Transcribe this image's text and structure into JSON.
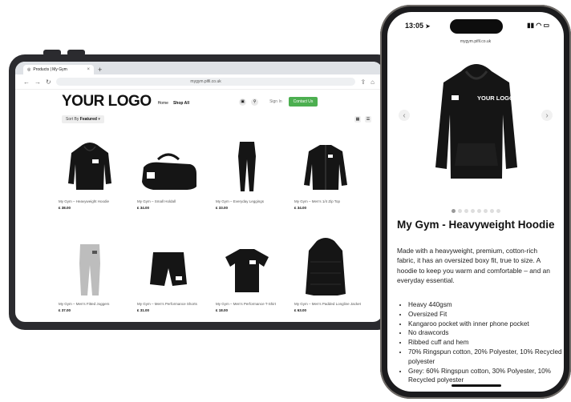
{
  "tablet": {
    "tab_title": "Products | My Gym",
    "tab_close": "×",
    "new_tab": "+",
    "url": "mygym.pifil.co.uk",
    "logo": "YOUR LOGO",
    "nav": [
      "Home",
      "Shop All"
    ],
    "sign_in": "Sign In",
    "contact": "Contact Us",
    "sort_prefix": "Sort By",
    "sort_value": "Featured",
    "products": [
      {
        "name": "My Gym – Heavyweight Hoodie",
        "price": "£ 38.00",
        "kind": "hoodie"
      },
      {
        "name": "My Gym – Small Holdall",
        "price": "£ 34.00",
        "kind": "bag"
      },
      {
        "name": "My Gym – Everyday Leggings",
        "price": "£ 33.00",
        "kind": "leggings"
      },
      {
        "name": "My Gym – Men's 1/4 Zip Top",
        "price": "£ 34.00",
        "kind": "zip"
      },
      {
        "name": "My Gym – Men's Fitted Joggers",
        "price": "£ 37.00",
        "kind": "joggers"
      },
      {
        "name": "My Gym – Men's Performance Shorts",
        "price": "£ 31.00",
        "kind": "shorts"
      },
      {
        "name": "My Gym – Men's Performance T-Shirt",
        "price": "£ 18.00",
        "kind": "tshirt"
      },
      {
        "name": "My Gym – Men's Padded Longline Jacket",
        "price": "£ 63.00",
        "kind": "jacket"
      }
    ]
  },
  "phone": {
    "time": "13:05",
    "url": "mygym.pifil.co.uk",
    "title": "My Gym - Heavyweight Hoodie",
    "description": "Made with a heavyweight, premium, cotton-rich fabric, it has an oversized boxy fit, true to size. A hoodie to keep you warm and comfortable – and an everyday essential.",
    "bullets": [
      "Heavy 440gsm",
      "Oversized Fit",
      "Kangaroo pocket with inner phone pocket",
      "No drawcords",
      "Ribbed cuff and hem",
      "70% Ringspun cotton, 20% Polyester, 10% Recycled polyester",
      "Grey: 60% Ringspun cotton, 30% Polyester, 10% Recycled polyester"
    ],
    "image_logo": "YOUR LOGO",
    "carousel_count": 8,
    "carousel_active": 1
  },
  "colors": {
    "device_frame": "#2b2b2f",
    "phone_frame": "#1b1b1d",
    "contact_button": "#4caf50",
    "garment": "#151515",
    "grey_garment": "#bdbdbd"
  },
  "icons": [
    "back-arrow-icon",
    "forward-arrow-icon",
    "reload-icon",
    "cart-icon",
    "search-icon",
    "grid-view-icon",
    "list-view-icon",
    "chevron-left-icon",
    "chevron-right-icon",
    "wifi-icon",
    "battery-icon",
    "signal-icon",
    "location-icon"
  ]
}
